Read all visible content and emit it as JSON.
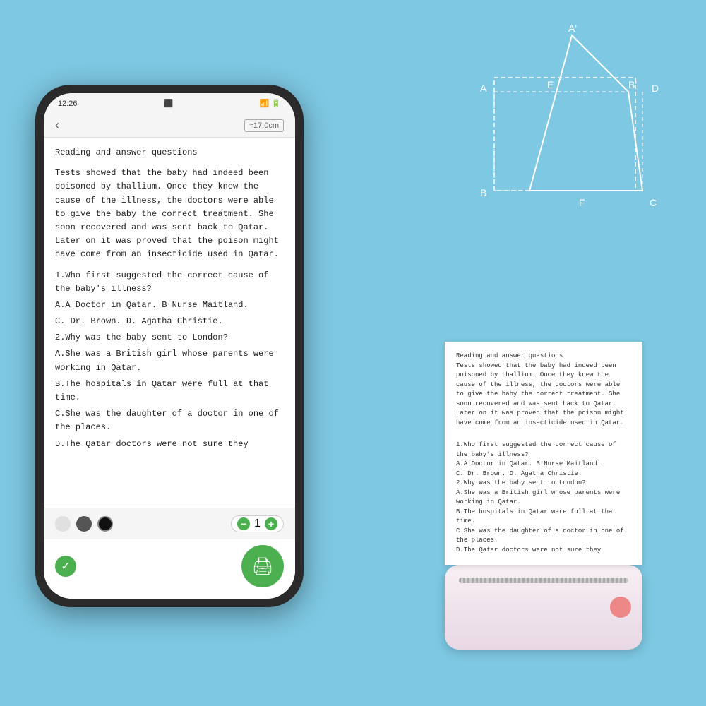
{
  "background_color": "#7ec8e3",
  "geometry": {
    "labels": {
      "A_prime": "A'",
      "A": "A",
      "E": "E",
      "B_prime": "B'",
      "D": "D",
      "B": "B",
      "F": "F",
      "C": "C"
    }
  },
  "phone": {
    "status_bar": {
      "time": "12:26",
      "signal": "5d",
      "battery": "●"
    },
    "nav": {
      "back": "‹",
      "measure": "≈17.0cm"
    },
    "reading_title": "Reading and answer questions",
    "reading_body": "Tests showed that the baby had indeed been poisoned by thallium. Once they knew the cause of the illness, the doctors were able to give the baby the correct treatment. She soon recovered and was sent back to Qatar. Later on it was proved that the poison might have come from an insecticide used in Qatar.",
    "q1": "1.Who first suggested the correct cause of the baby's illness?",
    "q1_a": "A.A Doctor in Qatar.    B Nurse Maitland.",
    "q1_b": "C. Dr. Brown.    D. Agatha Christie.",
    "q2": "2.Why was the baby sent to London?",
    "q2_a": "A.She was a British girl whose parents were working in Qatar.",
    "q2_b": "B.The hospitals in Qatar were full at that time.",
    "q2_c": "C.She was the daughter of a doctor in one of the places.",
    "q2_d": "D.The Qatar doctors were not sure they",
    "bottom": {
      "dot1": "white",
      "dot2": "dark",
      "dot3": "black",
      "minus": "−",
      "size": "1",
      "plus": "+"
    },
    "action": {
      "check": "✓",
      "print": "🖨"
    }
  },
  "paper": {
    "title": "Reading and answer questions",
    "body": "Tests showed that the baby had indeed\nbeen poisoned by thallium. Once they\nknew the cause of the illness, the doctors\nwere able to give the baby the correct\ntreatment. She soon recovered and was\nsent back to Qatar. Later on it was\nproved that the poison might have come\nfrom an insecticide used in Qatar.",
    "q1": "1.Who first suggested the correct cause of\nthe baby's illness?",
    "q1_a": "A.A Doctor in Qatar.    B Nurse Maitland.",
    "q1_b": "C. Dr. Brown.    D. Agatha Christie.",
    "q2": "2.Why was the baby sent to London?",
    "q2_a": "A.She was a British girl whose parents\nwere working in Qatar.",
    "q2_b": "B.The hospitals in Qatar were full at that\ntime.",
    "q2_c": "C.She was the daughter of a doctor in\none of the places.",
    "q2_d": "D.The Qatar doctors were not sure they"
  }
}
